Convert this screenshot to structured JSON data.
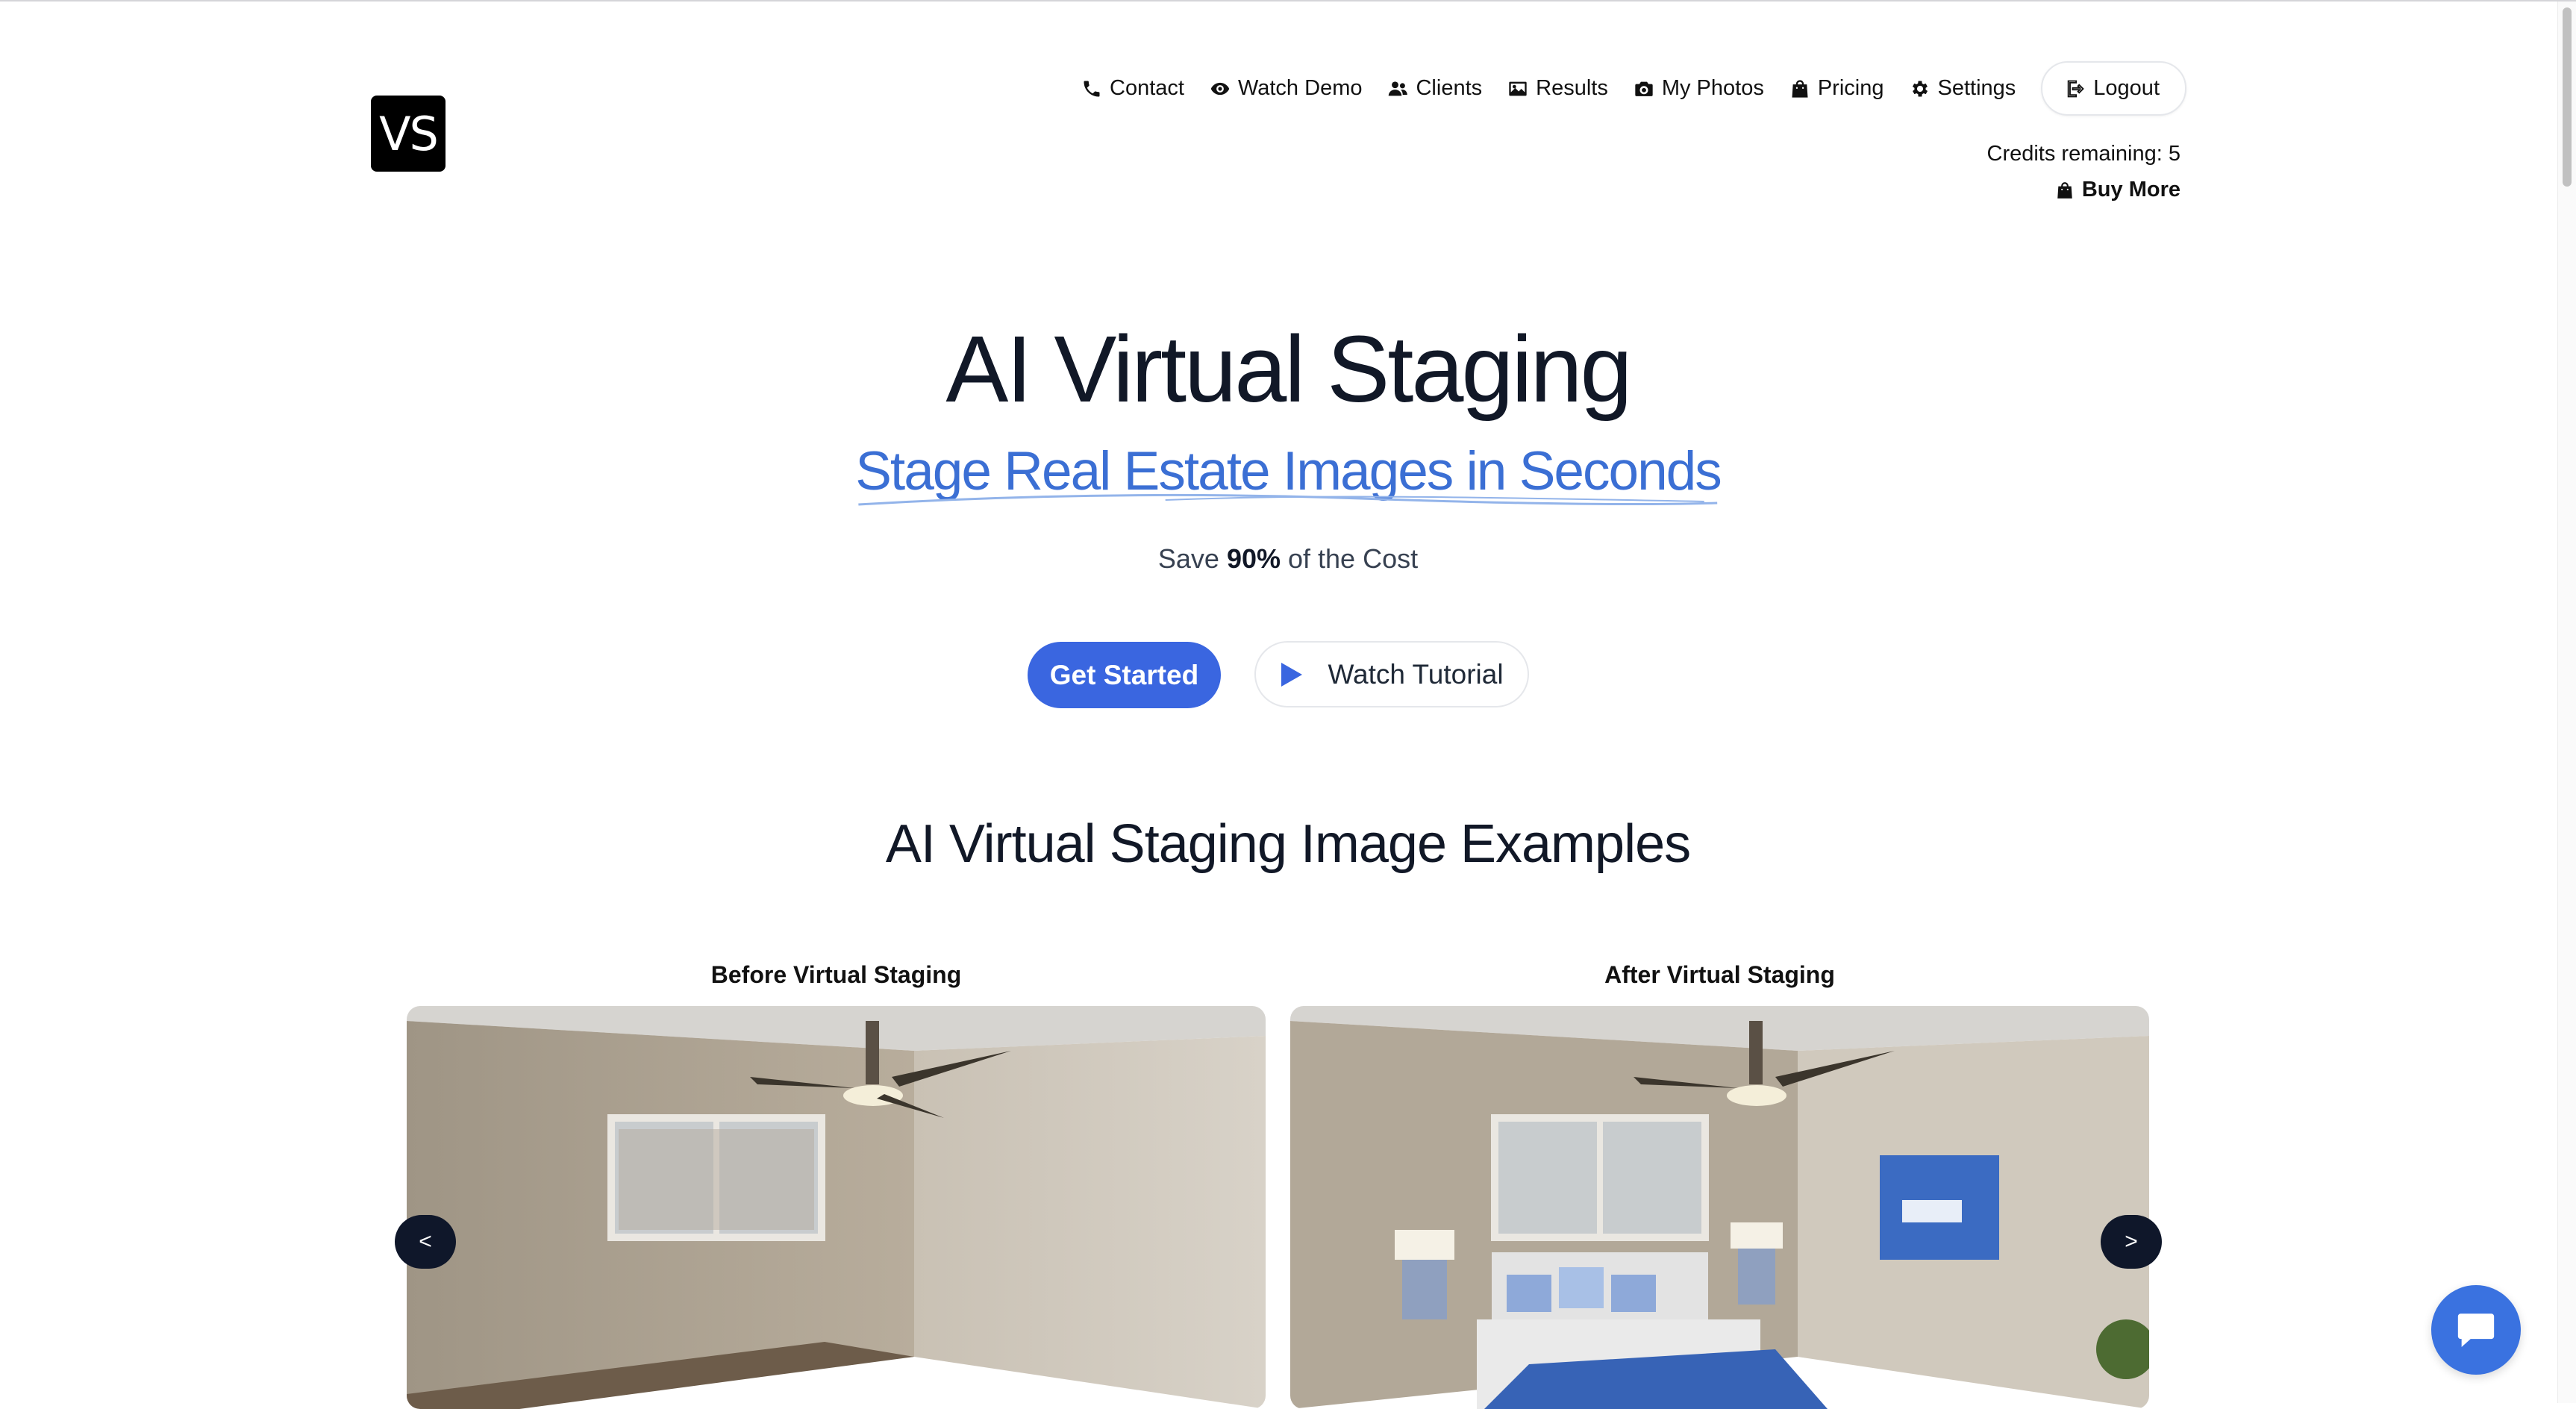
{
  "brand": {
    "logo_text": "VS"
  },
  "nav": {
    "contact": "Contact",
    "watch_demo": "Watch Demo",
    "clients": "Clients",
    "results": "Results",
    "my_photos": "My Photos",
    "pricing": "Pricing",
    "settings": "Settings",
    "logout": "Logout"
  },
  "account": {
    "credits": "Credits remaining: 5",
    "buy_more": "Buy More"
  },
  "hero": {
    "title": "AI Virtual Staging",
    "subtitle": "Stage Real Estate Images in Seconds",
    "save_prefix": "Save ",
    "save_bold": "90%",
    "save_suffix": " of the Cost",
    "cta_primary": "Get Started",
    "cta_secondary": "Watch Tutorial"
  },
  "examples": {
    "title": "AI Virtual Staging Image Examples",
    "before_label": "Before Virtual Staging",
    "after_label": "After Virtual Staging",
    "prev": "<",
    "next": ">"
  },
  "colors": {
    "accent": "#3a66e0",
    "subtitle": "#3b6fd4",
    "dark_button": "#0f172a",
    "chat": "#3a72e0"
  },
  "icons": {
    "contact": "phone-icon",
    "watch_demo": "eye-icon",
    "clients": "users-icon",
    "results": "image-icon",
    "my_photos": "camera-icon",
    "pricing": "shopping-bag-icon",
    "settings": "gear-icon",
    "logout": "logout-icon",
    "chat": "chat-icon"
  }
}
